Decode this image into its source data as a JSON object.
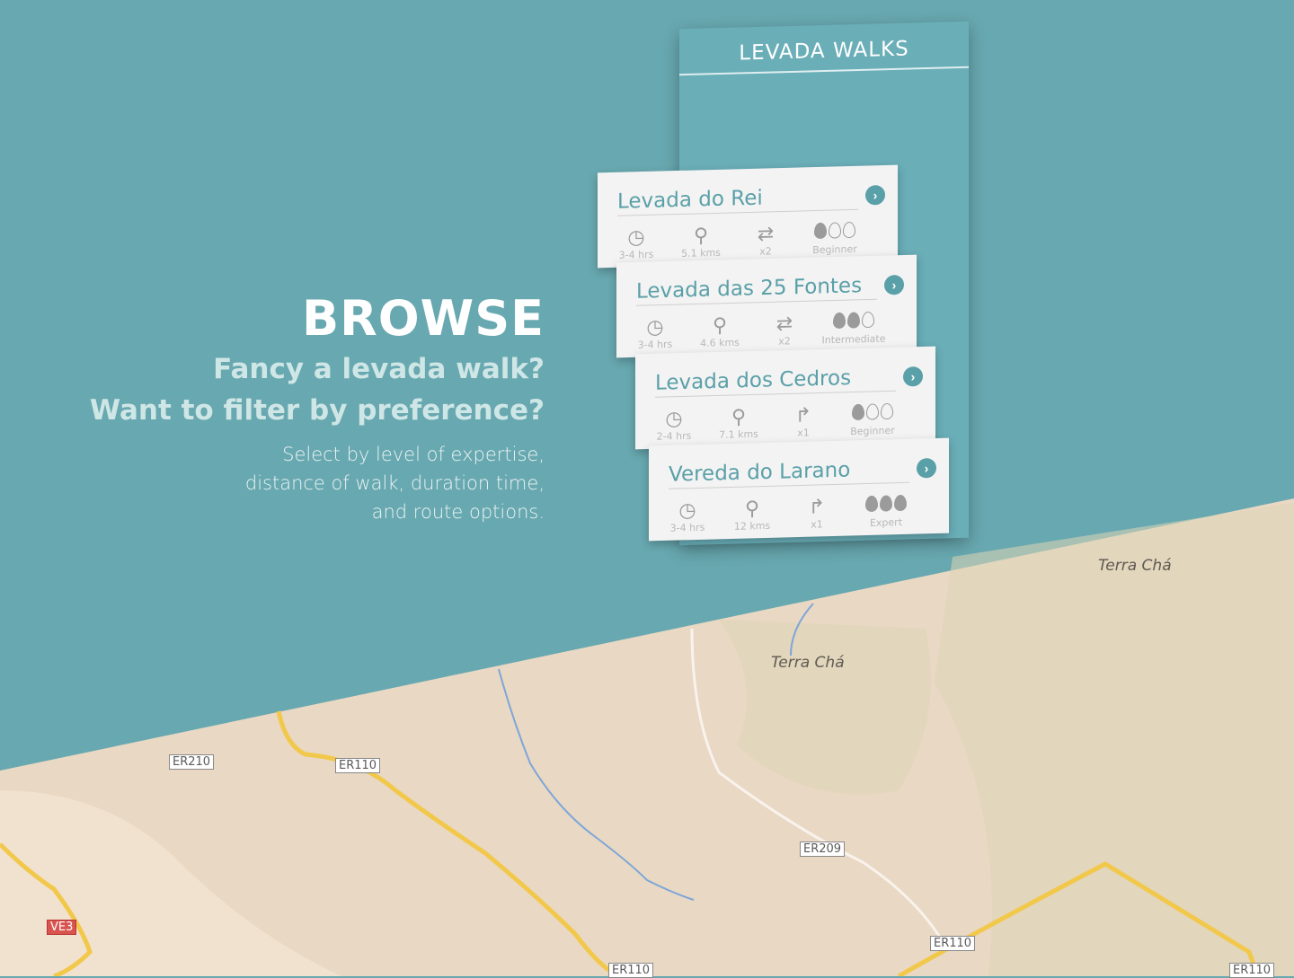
{
  "hero": {
    "title": "BROWSE",
    "sub1": "Fancy a levada walk?",
    "sub2": "Want to filter by preference?",
    "desc1": "Select by level of expertise,",
    "desc2": "distance of walk, duration time,",
    "desc3": "and route options."
  },
  "app": {
    "title": "LEVADA WALKS",
    "walks": [
      {
        "name": "Levada do Rei",
        "duration": "3-4 hrs",
        "distance": "5.1 kms",
        "route": "x2",
        "level": "Beginner",
        "level_value": 1,
        "route_icon": "loop-icon"
      },
      {
        "name": "Levada das 25 Fontes",
        "duration": "3-4 hrs",
        "distance": "4.6 kms",
        "route": "x2",
        "level": "Intermediate",
        "level_value": 2,
        "route_icon": "loop-icon"
      },
      {
        "name": "Levada dos Cedros",
        "duration": "2-4 hrs",
        "distance": "7.1 kms",
        "route": "x1",
        "level": "Beginner",
        "level_value": 1,
        "route_icon": "one-way-icon"
      },
      {
        "name": "Vereda do Larano",
        "duration": "3-4 hrs",
        "distance": "12 kms",
        "route": "x1",
        "level": "Expert",
        "level_value": 3,
        "route_icon": "one-way-icon"
      }
    ]
  },
  "map": {
    "places": [
      "Terra Chá",
      "Terra Chá"
    ],
    "roads": [
      "ER210",
      "ER110",
      "ER209",
      "ER110",
      "ER110",
      "ER110",
      "VE3"
    ]
  },
  "colors": {
    "teal": "#68a8b0",
    "accent": "#5aa0a8",
    "map_land": "#ead8c3",
    "map_green": "#dcd6b8",
    "road": "#f2c84b"
  }
}
